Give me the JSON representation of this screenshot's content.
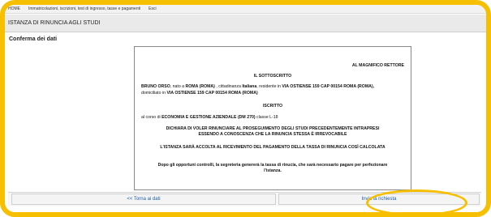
{
  "topnav": {
    "items": [
      "HOME",
      "Immatricolazioni, iscrizioni, test di ingresso, tasse e pagamenti",
      "Esci"
    ]
  },
  "titlebar": {
    "title": "ISTANZA DI RINUNCIA AGLI STUDI"
  },
  "section": {
    "title": "Conferma dei dati"
  },
  "document": {
    "addressee": "AL MAGNIFICO RETTORE",
    "heading1": "IL SOTTOSCRITTO",
    "name_line_prefix": "BRUNO ORSO",
    "name_line_rest": ", nato a ",
    "birth_city": "ROMA (ROMA)",
    "citizenship_prefix": " , cittadinanza ",
    "citizenship": "Italiana",
    "residence_prefix": ", residente in ",
    "residence": "VIA OSTIENSE 159 CAP 00154 ROMA (ROMA),",
    "domicile_prefix": "domiciliato in ",
    "domicile": "VIA OSTIENSE 159 CAP 00154 ROMA (ROMA)",
    "heading2": "ISCRITTO",
    "course_prefix": "al corso di ",
    "course": "ECONOMIA E GESTIONE AZIENDALE (DM 270)",
    "class": " classe L-18",
    "declaration": "DICHIARA DI VOLER RINUNCIARE AL PROSEGUIMENTO DEGLI STUDI PRECEDENTEMENTE INTRAPRESI ESSENDO A CONOSCENZA CHE LA RINUNCIA STESSA È IRREVOCABILE",
    "acceptance": "L'ISTANZA SARÀ ACCOLTA AL RICEVIMENTO DEL PAGAMENTO DELLA TASSA DI RINUNCIA COSÌ CALCOLATA",
    "note": "Dopo gli opportuni controlli, la segreteria genererà la tassa di rinucia, che sarà necessario pagare per perfezionare l'istanza."
  },
  "buttons": {
    "back": "<< Torna ai dati",
    "submit": "Invia la richiesta"
  },
  "colors": {
    "highlight": "#f6c000",
    "link": "#1f5fa8"
  }
}
